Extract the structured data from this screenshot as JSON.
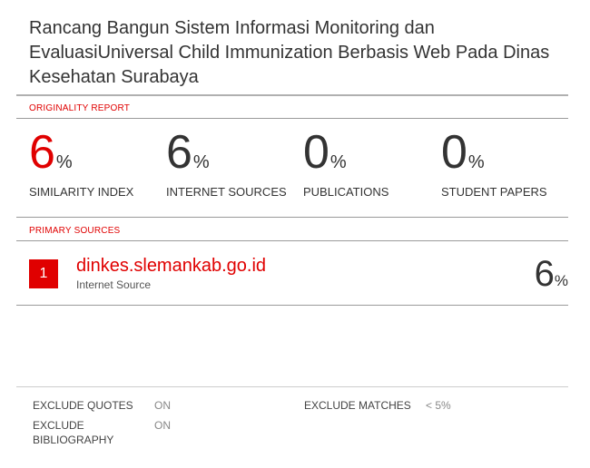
{
  "title": "Rancang Bangun Sistem Informasi Monitoring dan EvaluasiUniversal Child Immunization Berbasis Web Pada Dinas Kesehatan Surabaya",
  "originality_report_label": "ORIGINALITY REPORT",
  "stats": [
    {
      "value": "6",
      "unit": "%",
      "label": "SIMILARITY INDEX"
    },
    {
      "value": "6",
      "unit": "%",
      "label": "INTERNET SOURCES"
    },
    {
      "value": "0",
      "unit": "%",
      "label": "PUBLICATIONS"
    },
    {
      "value": "0",
      "unit": "%",
      "label": "STUDENT PAPERS"
    }
  ],
  "primary_sources_label": "PRIMARY SOURCES",
  "sources": [
    {
      "rank": "1",
      "url": "dinkes.slemankab.go.id",
      "type": "Internet Source",
      "value": "6",
      "unit": "%"
    }
  ],
  "footer": {
    "exclude_quotes_label": "EXCLUDE QUOTES",
    "exclude_quotes_value": "ON",
    "exclude_bibliography_label": "EXCLUDE BIBLIOGRAPHY",
    "exclude_bibliography_value": "ON",
    "exclude_matches_label": "EXCLUDE MATCHES",
    "exclude_matches_value": "< 5%"
  },
  "colors": {
    "accent": "#e00000",
    "text": "#333333",
    "rule": "#b0b0b0"
  }
}
